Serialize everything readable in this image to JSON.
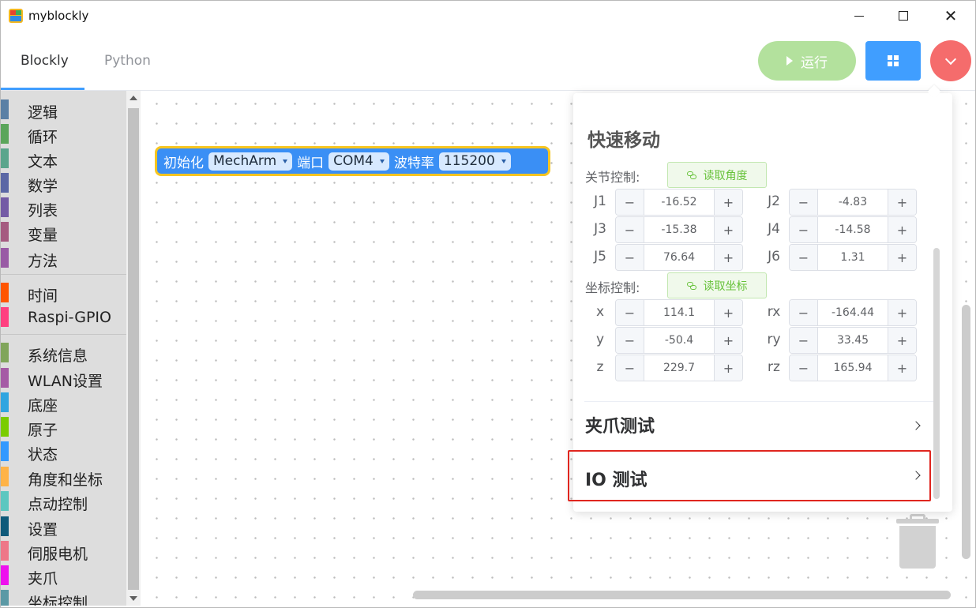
{
  "window": {
    "title": "myblockly",
    "minimize_icon": "minimize-icon",
    "maximize_icon": "maximize-icon",
    "close_glyph": "✕"
  },
  "tabs": [
    {
      "label": "Blockly",
      "active": true
    },
    {
      "label": "Python",
      "active": false
    }
  ],
  "toolbar": {
    "run_label": "运行",
    "accent_color": "#409eff",
    "run_color": "#b3e19d",
    "menu_color": "#f56c6c"
  },
  "toolbox": {
    "items": [
      {
        "label": "逻辑",
        "color": "#5b80a5"
      },
      {
        "label": "循环",
        "color": "#5ba55b"
      },
      {
        "label": "文本",
        "color": "#5ba58c"
      },
      {
        "label": "数学",
        "color": "#5b67a5"
      },
      {
        "label": "列表",
        "color": "#745ba5"
      },
      {
        "label": "变量",
        "color": "#a55b80"
      },
      {
        "label": "方法",
        "color": "#995ba5"
      },
      {
        "label": "时间",
        "color": "#ff5500"
      },
      {
        "label": "Raspi-GPIO",
        "color": "#ff4080"
      },
      {
        "label": "系统信息",
        "color": "#80a55b"
      },
      {
        "label": "WLAN设置",
        "color": "#a55ba5"
      },
      {
        "label": "底座",
        "color": "#30a5e0"
      },
      {
        "label": "原子",
        "color": "#7acc00"
      },
      {
        "label": "状态",
        "color": "#3399ff"
      },
      {
        "label": "角度和坐标",
        "color": "#ffb347"
      },
      {
        "label": "点动控制",
        "color": "#5cc7c0"
      },
      {
        "label": "设置",
        "color": "#0f5a7a"
      },
      {
        "label": "伺服电机",
        "color": "#ee7788"
      },
      {
        "label": "夹爪",
        "color": "#ee11ee"
      },
      {
        "label": "坐标控制",
        "color": "#5b99a5"
      }
    ]
  },
  "block": {
    "label_init": "初始化",
    "robot": "MechArm",
    "label_port": "端口",
    "port": "COM4",
    "label_baud": "波特率",
    "baud": "115200",
    "block_color": "#3a8ff5",
    "border_color": "#f7c520"
  },
  "panel": {
    "title": "快速移动",
    "joint_label": "关节控制:",
    "read_angle_label": "读取角度",
    "coord_label": "坐标控制:",
    "read_coord_label": "读取坐标",
    "joints": [
      {
        "name": "J1",
        "value": "-16.52"
      },
      {
        "name": "J2",
        "value": "-4.83"
      },
      {
        "name": "J3",
        "value": "-15.38"
      },
      {
        "name": "J4",
        "value": "-14.58"
      },
      {
        "name": "J5",
        "value": "76.64"
      },
      {
        "name": "J6",
        "value": "1.31"
      }
    ],
    "coords": [
      {
        "name": "x",
        "value": "114.1"
      },
      {
        "name": "rx",
        "value": "-164.44"
      },
      {
        "name": "y",
        "value": "-50.4"
      },
      {
        "name": "ry",
        "value": "33.45"
      },
      {
        "name": "z",
        "value": "229.7"
      },
      {
        "name": "rz",
        "value": "165.94"
      }
    ],
    "minus_glyph": "−",
    "plus_glyph": "+",
    "gripper_test": "夹爪测试",
    "io_test": "IO 测试"
  }
}
